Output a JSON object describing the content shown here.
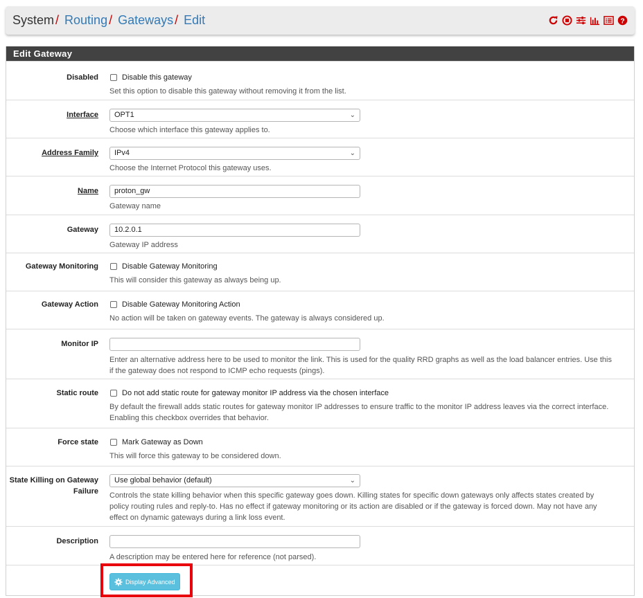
{
  "breadcrumb": {
    "items": [
      {
        "label": "System",
        "link": false
      },
      {
        "label": "Routing",
        "link": true
      },
      {
        "label": "Gateways",
        "link": true
      },
      {
        "label": "Edit",
        "link": true
      }
    ],
    "separator": "/"
  },
  "header_icons": [
    "reload-icon",
    "stop-icon",
    "sliders-icon",
    "chart-icon",
    "list-icon",
    "help-icon"
  ],
  "colors": {
    "accent_red": "#cc0000",
    "link_blue": "#337ab7",
    "panel_heading": "#424242",
    "info_button": "#5bc0de"
  },
  "panel": {
    "title": "Edit Gateway"
  },
  "fields": {
    "disabled": {
      "label": "Disabled",
      "checkbox_label": "Disable this gateway",
      "checked": false,
      "help": "Set this option to disable this gateway without removing it from the list."
    },
    "interface": {
      "label": "Interface",
      "value": "OPT1",
      "help": "Choose which interface this gateway applies to."
    },
    "address_family": {
      "label": "Address Family",
      "value": "IPv4",
      "help": "Choose the Internet Protocol this gateway uses."
    },
    "name": {
      "label": "Name",
      "value": "proton_gw",
      "help": "Gateway name"
    },
    "gateway": {
      "label": "Gateway",
      "value": "10.2.0.1",
      "help": "Gateway IP address"
    },
    "gateway_monitoring": {
      "label": "Gateway Monitoring",
      "checkbox_label": "Disable Gateway Monitoring",
      "checked": false,
      "help": "This will consider this gateway as always being up."
    },
    "gateway_action": {
      "label": "Gateway Action",
      "checkbox_label": "Disable Gateway Monitoring Action",
      "checked": false,
      "help": "No action will be taken on gateway events. The gateway is always considered up."
    },
    "monitor_ip": {
      "label": "Monitor IP",
      "value": "",
      "help": "Enter an alternative address here to be used to monitor the link. This is used for the quality RRD graphs as well as the load balancer entries. Use this if the gateway does not respond to ICMP echo requests (pings)."
    },
    "static_route": {
      "label": "Static route",
      "checkbox_label": "Do not add static route for gateway monitor IP address via the chosen interface",
      "checked": false,
      "help": "By default the firewall adds static routes for gateway monitor IP addresses to ensure traffic to the monitor IP address leaves via the correct interface. Enabling this checkbox overrides that behavior."
    },
    "force_state": {
      "label": "Force state",
      "checkbox_label": "Mark Gateway as Down",
      "checked": false,
      "help": "This will force this gateway to be considered down."
    },
    "state_killing": {
      "label_line1": "State Killing on Gateway",
      "label_line2": "Failure",
      "value": "Use global behavior (default)",
      "help": "Controls the state killing behavior when this specific gateway goes down. Killing states for specific down gateways only affects states created by policy routing rules and reply-to. Has no effect if gateway monitoring or its action are disabled or if the gateway is forced down. May not have any effect on dynamic gateways during a link loss event."
    },
    "description": {
      "label": "Description",
      "value": "",
      "help": "A description may be entered here for reference (not parsed)."
    }
  },
  "advanced_button": {
    "label": "Display Advanced",
    "icon": "gear-icon"
  }
}
